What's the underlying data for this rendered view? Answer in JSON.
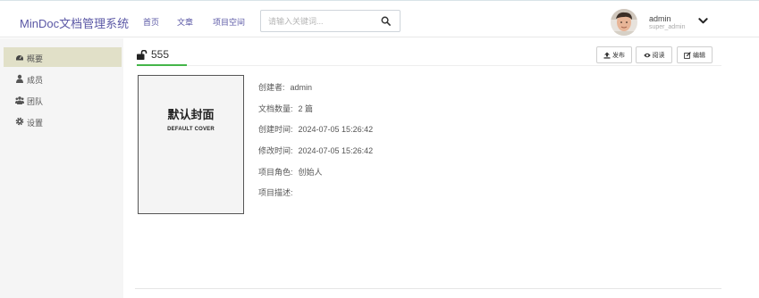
{
  "header": {
    "brand": "MinDoc文档管理系统",
    "nav": [
      "首页",
      "文章",
      "项目空间"
    ],
    "search_placeholder": "请输入关键词...",
    "user": {
      "name": "admin",
      "role": "super_admin"
    }
  },
  "sidebar": {
    "items": [
      {
        "label": "概要",
        "icon": "dashboard-icon",
        "active": true
      },
      {
        "label": "成员",
        "icon": "user-icon",
        "active": false
      },
      {
        "label": "团队",
        "icon": "users-icon",
        "active": false
      },
      {
        "label": "设置",
        "icon": "gear-icon",
        "active": false
      }
    ]
  },
  "main": {
    "title": "555",
    "actions": {
      "publish": "发布",
      "read": "阅读",
      "edit": "编辑"
    },
    "cover": {
      "cn": "默认封面",
      "en": "DEFAULT COVER"
    },
    "info": [
      {
        "label": "创建者:",
        "value": "admin"
      },
      {
        "label": "文档数量:",
        "value": "2 篇"
      },
      {
        "label": "创建时间:",
        "value": "2024-07-05 15:26:42"
      },
      {
        "label": "修改时间:",
        "value": "2024-07-05 15:26:42"
      },
      {
        "label": "项目角色:",
        "value": "创始人"
      },
      {
        "label": "项目描述:",
        "value": ""
      }
    ]
  },
  "colors": {
    "brand": "#5a57a5",
    "active_side": "#e1e0c8",
    "accent_green": "#44b549"
  }
}
